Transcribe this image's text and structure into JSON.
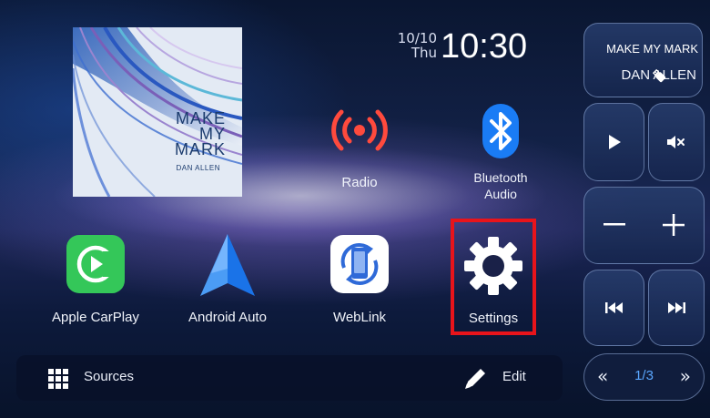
{
  "album": {
    "title_lines": [
      "MAKE",
      "MY",
      "MARK"
    ],
    "artist": "DAN ALLEN"
  },
  "clock": {
    "date_day": "10/10",
    "weekday": "Thu",
    "time": "10:30"
  },
  "tiles": {
    "radio": "Radio",
    "bluetooth_line1": "Bluetooth",
    "bluetooth_line2": "Audio",
    "carplay": "Apple CarPlay",
    "android_auto": "Android Auto",
    "weblink": "WebLink",
    "settings": "Settings"
  },
  "bottom_bar": {
    "sources_label": "Sources",
    "edit_label": "Edit"
  },
  "now_playing": {
    "title": "MAKE MY MARK",
    "artist": "DAN ALLEN",
    "source_icon": "usb-icon"
  },
  "pagination": {
    "prev_glyph": "«",
    "indicator": "1/3",
    "next_glyph": "»"
  },
  "colors": {
    "highlight_border": "#e8141b",
    "radio_icon": "#ff4a3d",
    "bluetooth": "#1a7cf5",
    "carplay": "#34c759",
    "page_indicator": "#5aa7ff"
  },
  "icons": [
    "radio-icon",
    "bluetooth-icon",
    "carplay-icon",
    "android-auto-icon",
    "weblink-icon",
    "gear-icon",
    "grid-icon",
    "pencil-icon",
    "play-icon",
    "mute-icon",
    "minus-icon",
    "plus-icon",
    "previous-track-icon",
    "next-track-icon",
    "usb-icon"
  ]
}
